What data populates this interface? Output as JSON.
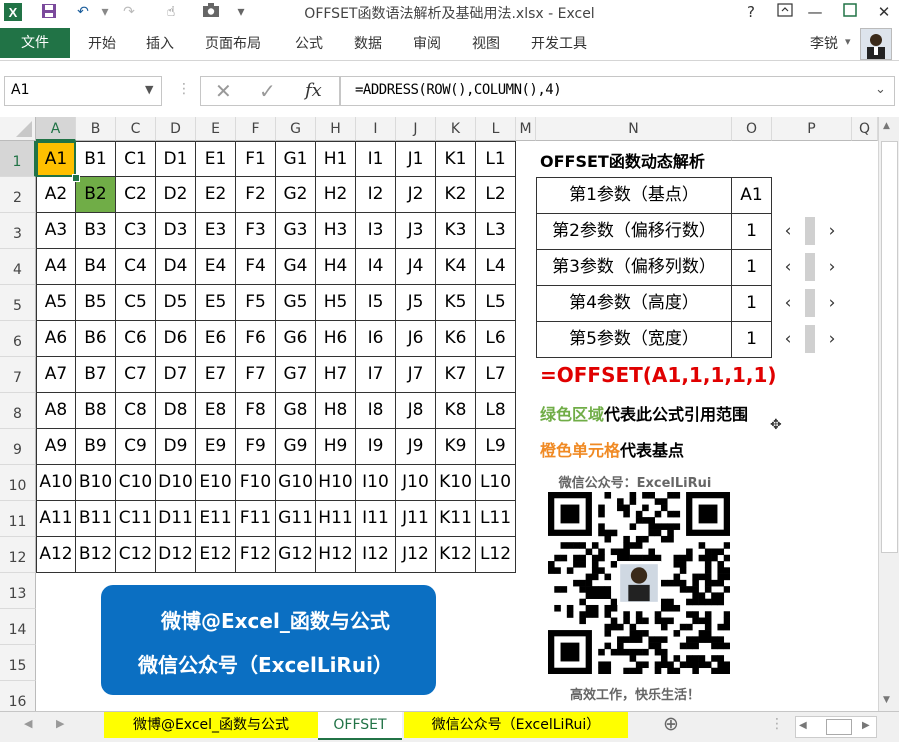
{
  "window": {
    "title": "OFFSET函数语法解析及基础用法.xlsx - Excel",
    "help": "?",
    "user": "李锐"
  },
  "ribbon": {
    "file": "文件",
    "tabs": [
      "开始",
      "插入",
      "页面布局",
      "公式",
      "数据",
      "审阅",
      "视图",
      "开发工具"
    ]
  },
  "formula_bar": {
    "name_box": "A1",
    "fx": "fx",
    "formula": "=ADDRESS(ROW(),COLUMN(),4)"
  },
  "columns": [
    "A",
    "B",
    "C",
    "D",
    "E",
    "F",
    "G",
    "H",
    "I",
    "J",
    "K",
    "L",
    "M",
    "N",
    "O",
    "P",
    "Q"
  ],
  "rows": [
    "1",
    "2",
    "3",
    "4",
    "5",
    "6",
    "7",
    "8",
    "9",
    "10",
    "11",
    "12",
    "13",
    "14",
    "15",
    "16"
  ],
  "grid_cells": [
    [
      "A1",
      "B1",
      "C1",
      "D1",
      "E1",
      "F1",
      "G1",
      "H1",
      "I1",
      "J1",
      "K1",
      "L1"
    ],
    [
      "A2",
      "B2",
      "C2",
      "D2",
      "E2",
      "F2",
      "G2",
      "H2",
      "I2",
      "J2",
      "K2",
      "L2"
    ],
    [
      "A3",
      "B3",
      "C3",
      "D3",
      "E3",
      "F3",
      "G3",
      "H3",
      "I3",
      "J3",
      "K3",
      "L3"
    ],
    [
      "A4",
      "B4",
      "C4",
      "D4",
      "E4",
      "F4",
      "G4",
      "H4",
      "I4",
      "J4",
      "K4",
      "L4"
    ],
    [
      "A5",
      "B5",
      "C5",
      "D5",
      "E5",
      "F5",
      "G5",
      "H5",
      "I5",
      "J5",
      "K5",
      "L5"
    ],
    [
      "A6",
      "B6",
      "C6",
      "D6",
      "E6",
      "F6",
      "G6",
      "H6",
      "I6",
      "J6",
      "K6",
      "L6"
    ],
    [
      "A7",
      "B7",
      "C7",
      "D7",
      "E7",
      "F7",
      "G7",
      "H7",
      "I7",
      "J7",
      "K7",
      "L7"
    ],
    [
      "A8",
      "B8",
      "C8",
      "D8",
      "E8",
      "F8",
      "G8",
      "H8",
      "I8",
      "J8",
      "K8",
      "L8"
    ],
    [
      "A9",
      "B9",
      "C9",
      "D9",
      "E9",
      "F9",
      "G9",
      "H9",
      "I9",
      "J9",
      "K9",
      "L9"
    ],
    [
      "A10",
      "B10",
      "C10",
      "D10",
      "E10",
      "F10",
      "G10",
      "H10",
      "I10",
      "J10",
      "K10",
      "L10"
    ],
    [
      "A11",
      "B11",
      "C11",
      "D11",
      "E11",
      "F11",
      "G11",
      "H11",
      "I11",
      "J11",
      "K11",
      "L11"
    ],
    [
      "A12",
      "B12",
      "C12",
      "D12",
      "E12",
      "F12",
      "G12",
      "H12",
      "I12",
      "J12",
      "K12",
      "L12"
    ]
  ],
  "panel": {
    "heading": "OFFSET函数动态解析",
    "params": [
      {
        "label": "第1参数（基点）",
        "value": "A1"
      },
      {
        "label": "第2参数（偏移行数）",
        "value": "1"
      },
      {
        "label": "第3参数（偏移列数）",
        "value": "1"
      },
      {
        "label": "第4参数（高度）",
        "value": "1"
      },
      {
        "label": "第5参数（宽度）",
        "value": "1"
      }
    ],
    "formula": "=OFFSET(A1,1,1,1,1)",
    "green_note_colored": "绿色区域",
    "green_note_rest": "代表此公式引用范围",
    "orange_note_colored": "橙色单元格",
    "orange_note_rest": "代表基点",
    "qr_caption": "微信公众号：ExcelLiRui",
    "qr_footer": "高效工作，快乐生活！"
  },
  "banner": {
    "line1": "微博@Excel_函数与公式",
    "line2": "微信公众号（ExcelLiRui）"
  },
  "sheet_tabs": [
    "微博@Excel_函数与公式",
    "OFFSET",
    "微信公众号（ExcelLiRui）"
  ],
  "colors": {
    "excel_green": "#217346",
    "orange_base": "#ffc000",
    "green_range": "#70ad47",
    "formula_red": "#e00000",
    "banner_blue": "#0b6fc2",
    "tab_yellow": "#ffff00"
  }
}
